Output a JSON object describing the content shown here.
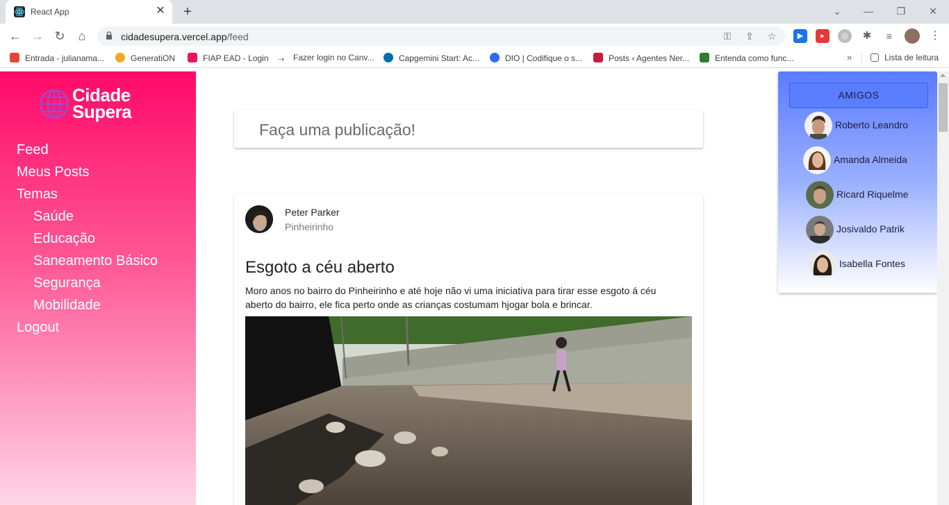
{
  "browser": {
    "tab_title": "React App",
    "url_host": "cidadesupera.vercel.app",
    "url_path": "/feed",
    "bookmarks": [
      {
        "label": "Entrada - julianama...",
        "color": "#ea4335"
      },
      {
        "label": "GeneratiON",
        "color": "#f5a623"
      },
      {
        "label": "FIAP EAD - Login",
        "color": "#ed145b"
      },
      {
        "label": "Fazer login no Canv...",
        "color": "#5f6368"
      },
      {
        "label": "Capgemini Start: Ac...",
        "color": "#0070ad"
      },
      {
        "label": "DIO | Codifique o s...",
        "color": "#2d6bff"
      },
      {
        "label": "Posts ‹ Agentes Ner...",
        "color": "#c41e3a"
      },
      {
        "label": "Entenda como func...",
        "color": "#2e7d32"
      }
    ],
    "reading_list": "Lista de leitura"
  },
  "sidebar": {
    "logo_line1": "Cidade",
    "logo_line2": "Supera",
    "menu": [
      {
        "label": "Feed"
      },
      {
        "label": "Meus Posts"
      },
      {
        "label": "Temas"
      },
      {
        "label": "Saúde"
      },
      {
        "label": "Educação"
      },
      {
        "label": "Saneamento Básico"
      },
      {
        "label": "Segurança"
      },
      {
        "label": "Mobilidade"
      },
      {
        "label": "Logout"
      }
    ]
  },
  "composer": {
    "placeholder": "Faça uma publicação!"
  },
  "post": {
    "author": "Peter Parker",
    "neighborhood": "Pinheirinho",
    "title": "Esgoto a céu aberto",
    "body": "Moro anos no bairro do Pinheirinho e até hoje não vi uma iniciativa para tirar esse esgoto á céu aberto do bairro, ele fica perto onde as crianças costumam hjogar bola e brincar."
  },
  "friends": {
    "header": "AMIGOS",
    "items": [
      {
        "name": "Roberto Leandro"
      },
      {
        "name": "Amanda Almeida"
      },
      {
        "name": "Ricard Riquelme"
      },
      {
        "name": "Josivaldo Patrik"
      },
      {
        "name": "Isabella Fontes"
      }
    ]
  },
  "colors": {
    "sidebar_top": "#ff0a68",
    "friends_top": "#5a7bff"
  }
}
